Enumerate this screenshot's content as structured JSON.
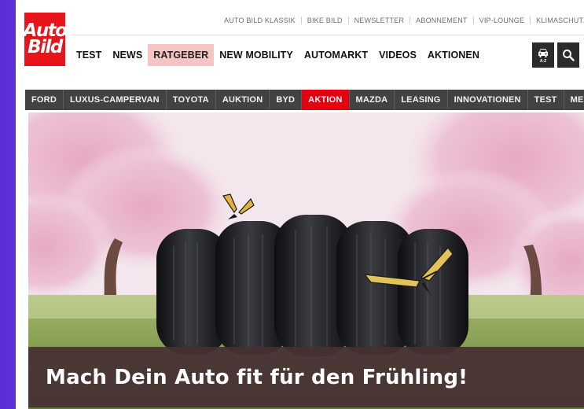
{
  "brand": {
    "logo_line1": "Auto",
    "logo_line2": "Bild"
  },
  "top_links": [
    "AUTO BILD KLASSIK",
    "BIKE BILD",
    "NEWSLETTER",
    "ABONNEMENT",
    "VIP-LOUNGE",
    "KLIMASCHUTZ"
  ],
  "main_nav": [
    {
      "label": "TEST",
      "active": false
    },
    {
      "label": "NEWS",
      "active": false
    },
    {
      "label": "RATGEBER",
      "active": true
    },
    {
      "label": "NEW MOBILITY",
      "active": false
    },
    {
      "label": "AUTOMARKT",
      "active": false
    },
    {
      "label": "VIDEOS",
      "active": false
    },
    {
      "label": "AKTIONEN",
      "active": false
    }
  ],
  "header_icons": {
    "car_label": "A-Z",
    "car_icon": "car-icon",
    "search_icon": "search-icon"
  },
  "tag_nav": [
    {
      "label": "FORD",
      "active": false
    },
    {
      "label": "LUXUS-CAMPERVAN",
      "active": false
    },
    {
      "label": "TOYOTA",
      "active": false
    },
    {
      "label": "AUKTION",
      "active": false
    },
    {
      "label": "BYD",
      "active": false
    },
    {
      "label": "AKTION",
      "active": true
    },
    {
      "label": "MAZDA",
      "active": false
    },
    {
      "label": "LEASING",
      "active": false
    },
    {
      "label": "INNOVATIONEN",
      "active": false
    },
    {
      "label": "TEST",
      "active": false
    },
    {
      "label": "ME",
      "active": false
    }
  ],
  "hero": {
    "headline": "Mach Dein Auto fit für den Frühling!"
  },
  "colors": {
    "brand_red": "#e3000f",
    "active_nav_bg": "#f7c4c4",
    "tag_nav_bg": "#424242"
  }
}
